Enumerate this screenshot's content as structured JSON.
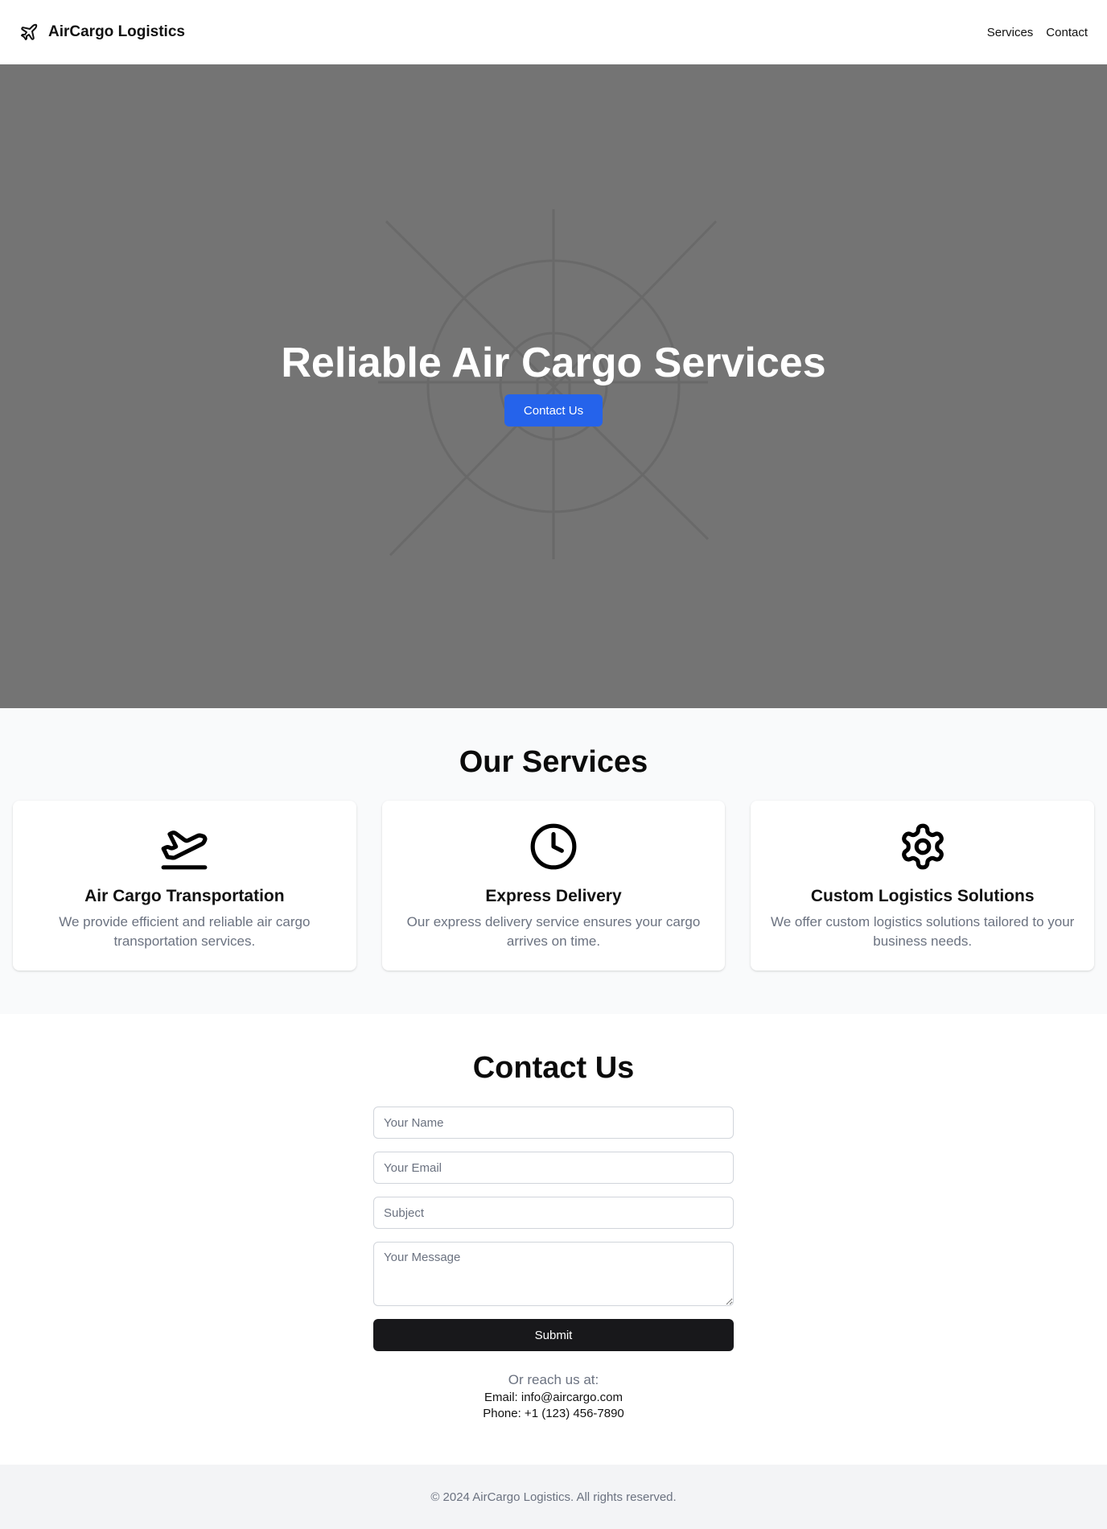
{
  "header": {
    "brand": "AirCargo Logistics",
    "brand_icon": "plane-icon",
    "nav": [
      "Services",
      "Contact"
    ]
  },
  "hero": {
    "title": "Reliable Air Cargo Services",
    "cta": "Contact Us"
  },
  "services": {
    "title": "Our Services",
    "items": [
      {
        "icon": "plane-takeoff-icon",
        "title": "Air Cargo Transportation",
        "text": "We provide efficient and reliable air cargo transportation services."
      },
      {
        "icon": "clock-icon",
        "title": "Express Delivery",
        "text": "Our express delivery service ensures your cargo arrives on time."
      },
      {
        "icon": "gear-icon",
        "title": "Custom Logistics Solutions",
        "text": "We offer custom logistics solutions tailored to your business needs."
      }
    ]
  },
  "contact": {
    "title": "Contact Us",
    "form": {
      "name_placeholder": "Your Name",
      "email_placeholder": "Your Email",
      "subject_placeholder": "Subject",
      "message_placeholder": "Your Message",
      "submit": "Submit"
    },
    "reach": {
      "heading": "Or reach us at:",
      "email": "Email: info@aircargo.com",
      "phone": "Phone: +1 (123) 456-7890"
    }
  },
  "footer": {
    "text": "© 2024 AirCargo Logistics. All rights reserved."
  },
  "colors": {
    "accent": "#2563eb",
    "hero_background": "#747474",
    "submit_background": "#18181b"
  }
}
